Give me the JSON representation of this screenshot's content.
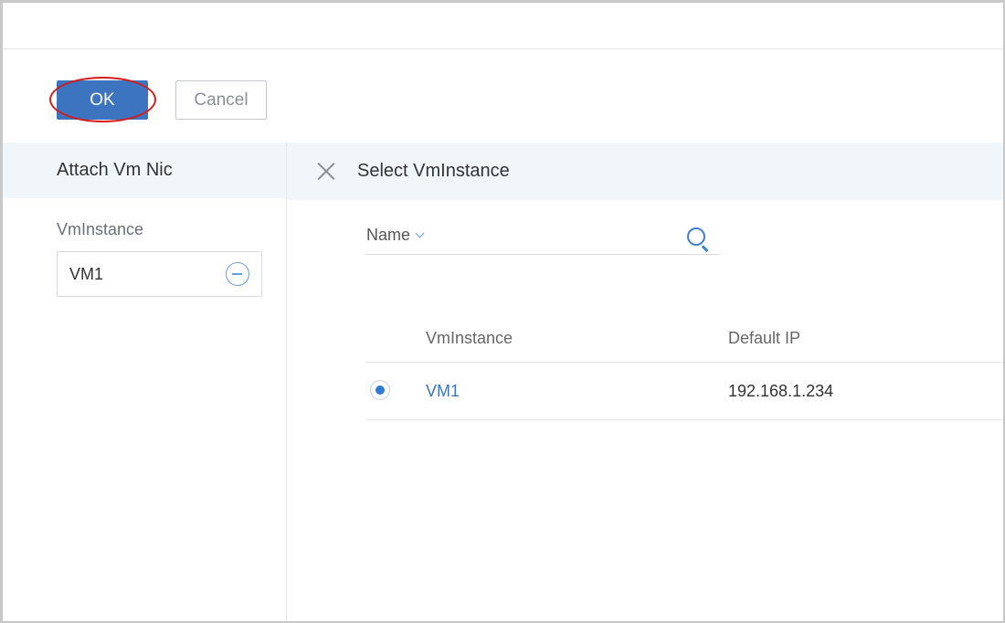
{
  "toolbar": {
    "ok_label": "OK",
    "cancel_label": "Cancel"
  },
  "left_panel": {
    "title": "Attach Vm Nic",
    "field_label": "VmInstance",
    "field_value": "VM1",
    "remove_icon": "minus-circle-icon"
  },
  "right_panel": {
    "title": "Select VmInstance",
    "close_icon": "close-icon",
    "search": {
      "field_selector": "Name",
      "icon": "search-icon"
    },
    "table": {
      "columns": [
        "VmInstance",
        "Default IP"
      ],
      "rows": [
        {
          "selected": true,
          "name": "VM1",
          "ip": "192.168.1.234"
        }
      ]
    }
  },
  "colors": {
    "primary": "#3d74bf",
    "highlight": "#d41c1c",
    "panel_header_bg": "#f1f6fb"
  }
}
